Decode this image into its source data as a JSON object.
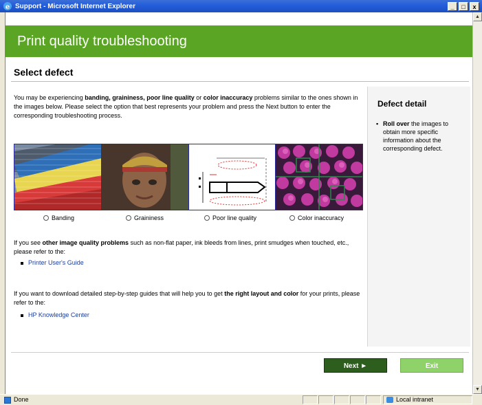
{
  "window": {
    "title": "Support - Microsoft Internet Explorer",
    "minimize": "_",
    "maximize": "□",
    "close": "x"
  },
  "header": {
    "title": "Print quality troubleshooting"
  },
  "page": {
    "title": "Select defect"
  },
  "intro": {
    "part1": "You may be experiencing ",
    "bold1": "banding, graininess, poor line quality",
    "part2": " or ",
    "bold2": "color inaccuracy",
    "part3": " problems similar to the ones shown in the images below. Please select the option that best represents your problem and press the Next button to enter the corresponding troubleshooting process."
  },
  "defects": [
    {
      "label": "Banding"
    },
    {
      "label": "Graininess"
    },
    {
      "label": "Poor line quality"
    },
    {
      "label": "Color inaccuracy"
    }
  ],
  "other_problems": {
    "part1": "If you see ",
    "bold": "other image quality problems",
    "part2": " such as non-flat paper, ink bleeds from lines, print smudges when touched, etc., please refer to the:",
    "link": "Printer User's Guide"
  },
  "download": {
    "part1": "If you want to download detailed step-by-step guides that will help you to get ",
    "bold": "the right layout and color",
    "part2": " for your prints, please refer to the:",
    "link": "HP Knowledge Center"
  },
  "side": {
    "title": "Defect detail",
    "bold": "Roll over",
    "text": " the images to obtain more specific information about the corresponding defect."
  },
  "buttons": {
    "next": "Next ►",
    "exit": "Exit"
  },
  "status": {
    "text": "Done",
    "zone": "Local intranet"
  },
  "colors": {
    "header_green": "#5aa624",
    "next_bg": "#2e5e1e",
    "exit_bg": "#8fd269",
    "link": "#1a3d9a"
  }
}
